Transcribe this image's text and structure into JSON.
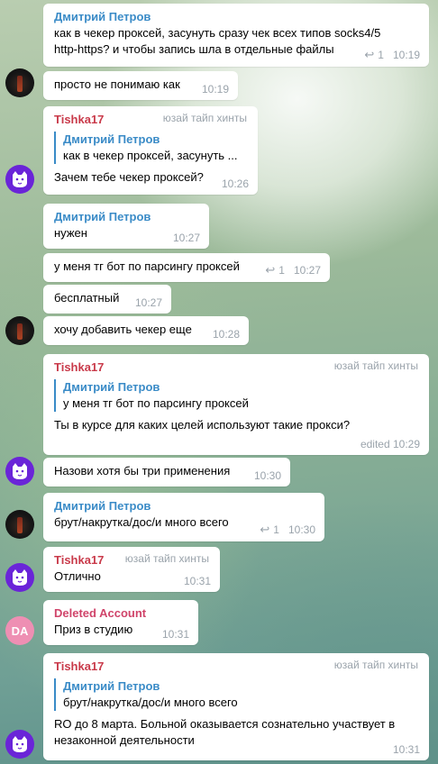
{
  "messages": [
    {
      "author": "Дмитрий Петров",
      "lines": [
        "как в чекер проксей, засунуть сразу чек всех типов socks4/5",
        "http-https? и чтобы запись шла в отдельные файлы"
      ],
      "replies": "1",
      "time": "10:19"
    },
    {
      "lines": [
        "просто не понимаю как"
      ],
      "time": "10:19"
    },
    {
      "author": "Tishka17",
      "role": "юзай тайп хинты",
      "quote": {
        "author": "Дмитрий Петров",
        "text": "как в чекер проксей, засунуть ..."
      },
      "lines": [
        "Зачем тебе чекер проксей?"
      ],
      "time": "10:26"
    },
    {
      "author": "Дмитрий Петров",
      "lines": [
        "нужен"
      ],
      "time": "10:27"
    },
    {
      "lines": [
        "у меня тг бот по парсингу проксей"
      ],
      "replies": "1",
      "time": "10:27"
    },
    {
      "lines": [
        "бесплатный"
      ],
      "time": "10:27"
    },
    {
      "lines": [
        "хочу добавить чекер еще"
      ],
      "time": "10:28"
    },
    {
      "author": "Tishka17",
      "role": "юзай тайп хинты",
      "quote": {
        "author": "Дмитрий Петров",
        "text": "у меня тг бот по парсингу проксей"
      },
      "lines": [
        "Ты в курсе для каких целей используют такие прокси?"
      ],
      "time": "edited 10:29"
    },
    {
      "lines": [
        "Назови хотя бы три применения"
      ],
      "time": "10:30"
    },
    {
      "author": "Дмитрий Петров",
      "lines": [
        "брут/накрутка/дос/и много всего"
      ],
      "replies": "1",
      "time": "10:30"
    },
    {
      "author": "Tishka17",
      "role": "юзай тайп хинты",
      "lines": [
        "Отлично"
      ],
      "time": "10:31"
    },
    {
      "author": "Deleted Account",
      "lines": [
        "Приз в студию"
      ],
      "time": "10:31"
    },
    {
      "author": "Tishka17",
      "role": "юзай тайп хинты",
      "quote": {
        "author": "Дмитрий Петров",
        "text": "брут/накрутка/дос/и много всего"
      },
      "lines": [
        "RO до 8 марта. Больной оказывается сознательно участвует в",
        "незаконной деятельности"
      ],
      "time": "10:31"
    }
  ],
  "avatars": {
    "deleted_initials": "DA",
    "colors": {
      "tishka": "#6a24d8",
      "deleted": "#ee8fb3",
      "link": "#3a8bc7",
      "tishka_name": "#c93a4a",
      "deleted_name": "#d0446a"
    }
  },
  "icons": {
    "reply": "reply-arrow-icon",
    "cat": "cat-face-icon"
  }
}
